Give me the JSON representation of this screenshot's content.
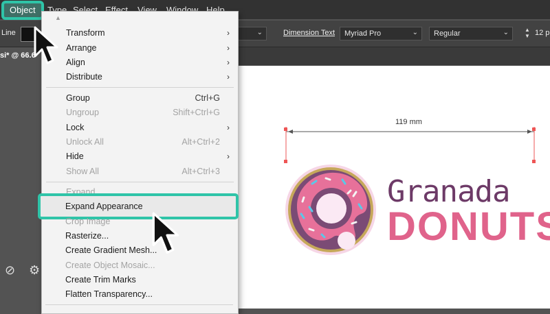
{
  "menubar": {
    "object": "Object",
    "items": [
      "Type",
      "Select",
      "Effect",
      "View",
      "Window",
      "Help"
    ]
  },
  "controlbar": {
    "stroke_label": "Line",
    "dimension_text": "Dimension Text",
    "font": "Myriad Pro",
    "style": "Regular",
    "size": "12 p"
  },
  "tab": {
    "title": "si* @ 66.6"
  },
  "menu": {
    "items": [
      {
        "label": "Transform",
        "shortcut": "",
        "submenu": true,
        "disabled": false
      },
      {
        "label": "Arrange",
        "shortcut": "",
        "submenu": true,
        "disabled": false
      },
      {
        "label": "Align",
        "shortcut": "",
        "submenu": true,
        "disabled": false
      },
      {
        "label": "Distribute",
        "shortcut": "",
        "submenu": true,
        "disabled": false
      },
      {
        "label": "Group",
        "shortcut": "Ctrl+G",
        "submenu": false,
        "disabled": false
      },
      {
        "label": "Ungroup",
        "shortcut": "Shift+Ctrl+G",
        "submenu": false,
        "disabled": true
      },
      {
        "label": "Lock",
        "shortcut": "",
        "submenu": true,
        "disabled": false
      },
      {
        "label": "Unlock All",
        "shortcut": "Alt+Ctrl+2",
        "submenu": false,
        "disabled": true
      },
      {
        "label": "Hide",
        "shortcut": "",
        "submenu": true,
        "disabled": false
      },
      {
        "label": "Show All",
        "shortcut": "Alt+Ctrl+3",
        "submenu": false,
        "disabled": true
      },
      {
        "label": "Expand...",
        "shortcut": "",
        "submenu": false,
        "disabled": true
      },
      {
        "label": "Expand Appearance",
        "shortcut": "",
        "submenu": false,
        "disabled": false
      },
      {
        "label": "Crop Image",
        "shortcut": "",
        "submenu": false,
        "disabled": true
      },
      {
        "label": "Rasterize...",
        "shortcut": "",
        "submenu": false,
        "disabled": false
      },
      {
        "label": "Create Gradient Mesh...",
        "shortcut": "",
        "submenu": false,
        "disabled": false
      },
      {
        "label": "Create Object Mosaic...",
        "shortcut": "",
        "submenu": false,
        "disabled": true
      },
      {
        "label": "Create Trim Marks",
        "shortcut": "",
        "submenu": false,
        "disabled": false
      },
      {
        "label": "Flatten Transparency...",
        "shortcut": "",
        "submenu": false,
        "disabled": false
      }
    ]
  },
  "artboard": {
    "dimension_label": "119 mm",
    "logo_line1": "Granada",
    "logo_line2": "DONUTS"
  },
  "colors": {
    "highlight": "#2fc4a8",
    "donut_pink": "#e0638b",
    "brand_purple": "#6d3a67"
  }
}
